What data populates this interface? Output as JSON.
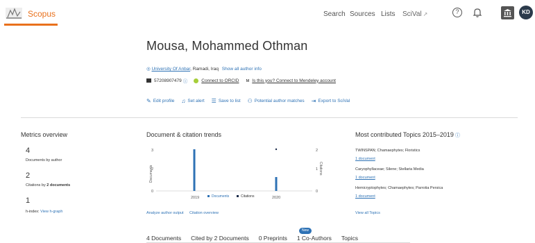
{
  "header": {
    "brand": "Scopus",
    "nav": [
      "Search",
      "Sources",
      "Lists",
      "SciVal"
    ],
    "scival_ext": "↗",
    "help_glyph": "?",
    "avatar_initials": "KD",
    "accent_color": "#e9711c"
  },
  "author": {
    "name": "Mousa, Mohammed Othman",
    "affiliation": "University Of Anbar",
    "location": ", Ramadi, Iraq",
    "show_all_affiliations": "Show all author info",
    "scopus_id": "57208907479",
    "connect_orcid": "Connect to ORCID",
    "mendeley_text": "Is this you? Connect to Mendeley account",
    "actions": [
      "Edit profile",
      "Set alert",
      "Save to list",
      "Potential author matches",
      "Export to SciVal"
    ]
  },
  "metrics": {
    "title": "Metrics overview",
    "documents_value": "4",
    "documents_label": "Documents by author",
    "citations_value": "2",
    "citations_label": "Citations by ",
    "citations_label_bold": "2 documents",
    "hindex_value": "1",
    "hindex_label": "h-index:",
    "hindex_link": "View h-graph"
  },
  "trends": {
    "title": "Document & citation trends",
    "analyze_link": "Analyze author output",
    "citation_link": "Citation overview"
  },
  "chart_data": {
    "type": "bar",
    "categories": [
      "2019",
      "2020"
    ],
    "series": [
      {
        "name": "Documents",
        "values": [
          3,
          1
        ],
        "color": "#2e72b5"
      },
      {
        "name": "Citations",
        "values": [
          0,
          2
        ],
        "color": "#1a2a4a"
      }
    ],
    "ylabel_left": "Documents",
    "ylabel_right": "Citations",
    "y_ticks_left": [
      "3",
      "2",
      "0"
    ],
    "y_ticks_right": [
      "2",
      "1",
      "0"
    ],
    "ylim_left": [
      0,
      3
    ],
    "ylim_right": [
      0,
      2
    ],
    "legend_position": "bottom"
  },
  "topics": {
    "title": "Most contributed Topics 2015–2019",
    "info_glyph": "ⓘ",
    "items": [
      {
        "name": "TWINSPAN; Chamaephytes; Floristics",
        "count": "1 document"
      },
      {
        "name": "Caryophyllaceae; Silene; Stellaria Media",
        "count": "1 document"
      },
      {
        "name": "Hemicryptophytes; Chamaephytes; Parrotia Persica",
        "count": "1 document"
      }
    ],
    "view_all": "View all Topics"
  },
  "tabs": {
    "items": [
      "4 Documents",
      "Cited by 2 Documents",
      "0 Preprints",
      "1 Co-Authors",
      "Topics"
    ],
    "new_badge": "New"
  }
}
